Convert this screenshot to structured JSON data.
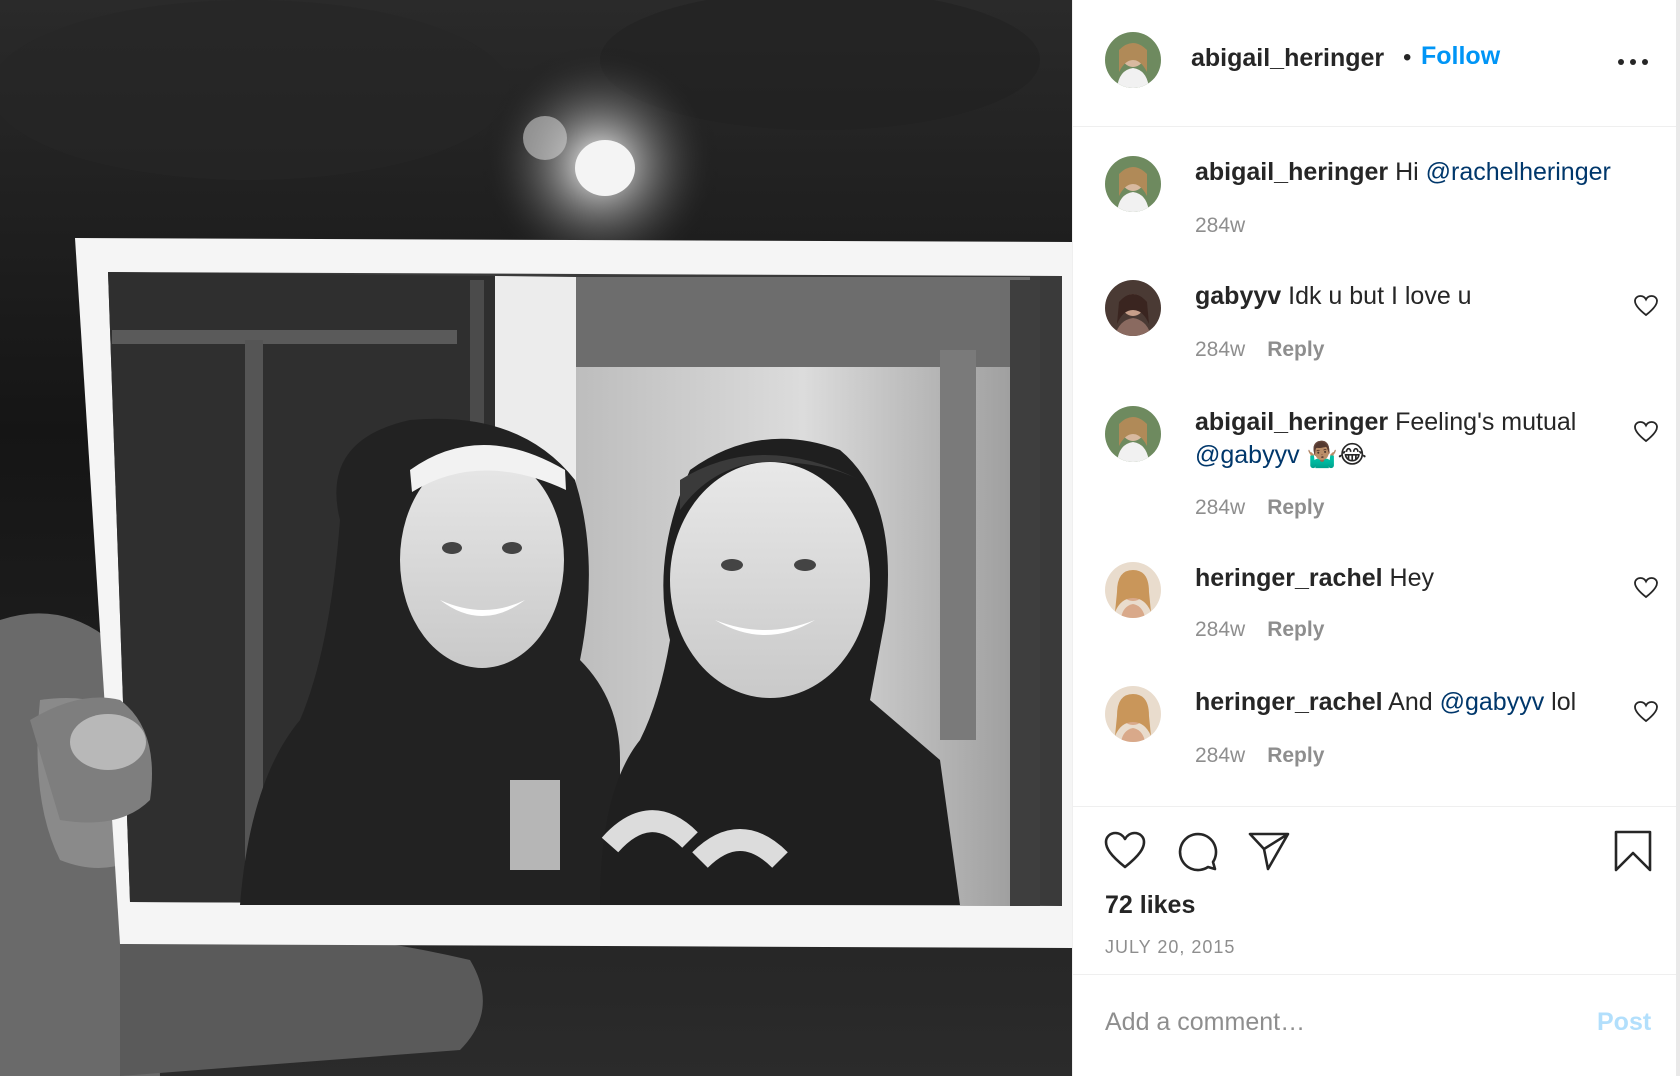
{
  "header": {
    "username": "abigail_heringer",
    "dot": "•",
    "follow_label": "Follow"
  },
  "comments": [
    {
      "username": "abigail_heringer",
      "text_before": "Hi ",
      "mention": "@rachelheringer",
      "text_after": "",
      "time": "284w",
      "reply": ""
    },
    {
      "username": "gabyyv",
      "text_before": "Idk u but I love u",
      "mention": "",
      "text_after": "",
      "time": "284w",
      "reply": "Reply"
    },
    {
      "username": "abigail_heringer",
      "text_before": "Feeling's mutual ",
      "mention": "@gabyyv",
      "text_after": " 🤷🏽‍♂️😂",
      "time": "284w",
      "reply": "Reply"
    },
    {
      "username": "heringer_rachel",
      "text_before": "Hey",
      "mention": "",
      "text_after": "",
      "time": "284w",
      "reply": "Reply"
    },
    {
      "username": "heringer_rachel",
      "text_before": "And ",
      "mention": "@gabyyv",
      "text_after": " lol",
      "time": "284w",
      "reply": "Reply"
    }
  ],
  "likes": "72 likes",
  "date": "JULY 20, 2015",
  "add_comment": {
    "placeholder": "Add a comment…"
  },
  "post_label": "Post",
  "icons": {
    "like": "heart-icon",
    "comment": "comment-icon",
    "share": "paper-plane-icon",
    "save": "bookmark-icon",
    "more": "more-options-icon"
  },
  "colors": {
    "follow": "#0095f6",
    "mention": "#00376b",
    "muted": "#8e8e8e",
    "post_disabled": "#b2dffc"
  }
}
